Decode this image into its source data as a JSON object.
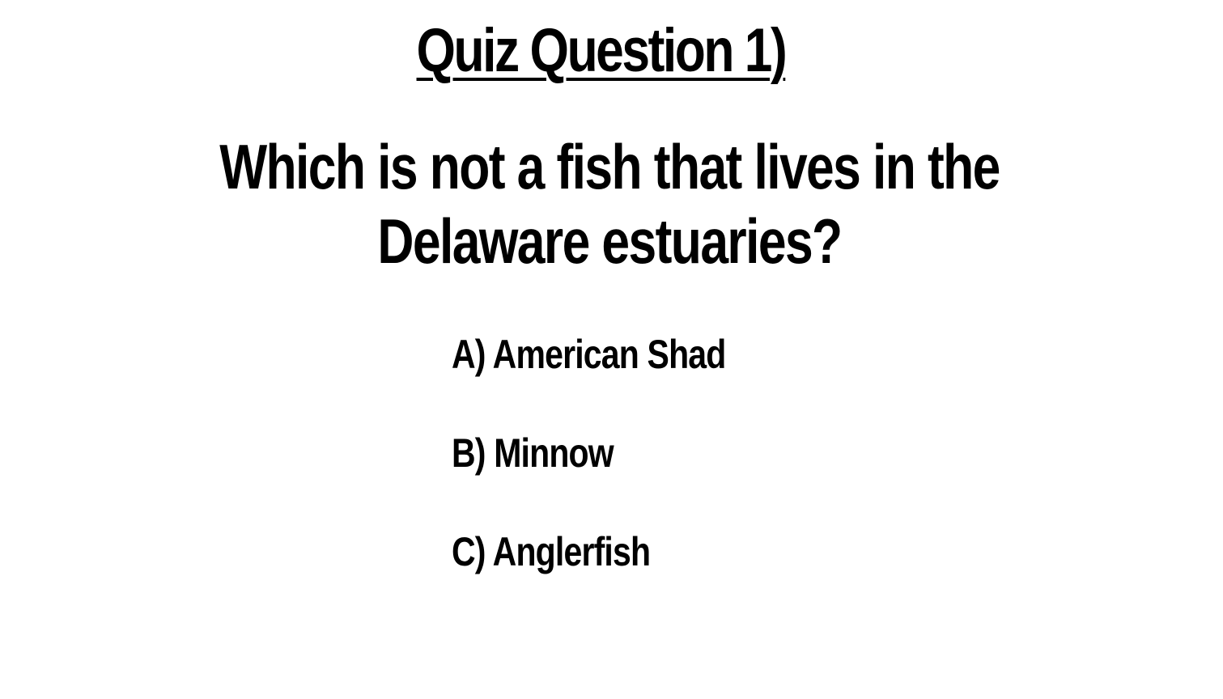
{
  "slide": {
    "title": "Quiz Question 1)",
    "question": "Which is not a fish that lives in the Delaware estuaries?",
    "options": [
      {
        "label": "A) American Shad"
      },
      {
        "label": "B) Minnow"
      },
      {
        "label": "C) Anglerfish"
      }
    ],
    "colors": {
      "background": "#ffffff",
      "text": "#000000"
    }
  }
}
